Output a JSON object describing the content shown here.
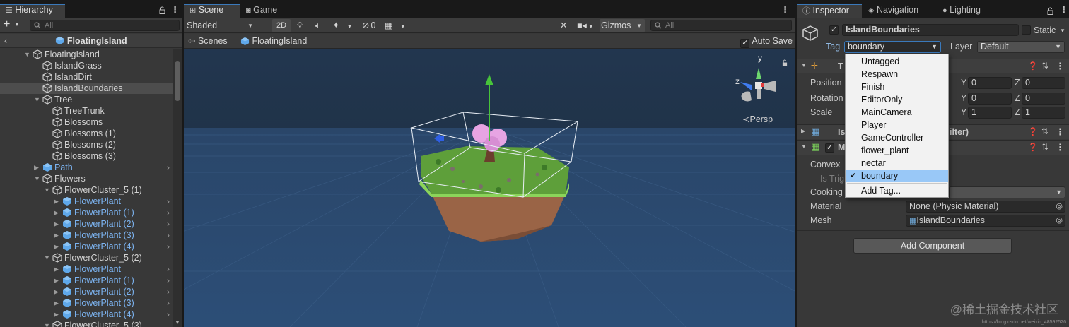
{
  "hierarchy": {
    "tab_label": "Hierarchy",
    "search_placeholder": "All",
    "header_title": "FloatingIsland",
    "items": [
      {
        "label": "FloatingIsland"
      },
      {
        "label": "IslandGrass"
      },
      {
        "label": "IslandDirt"
      },
      {
        "label": "IslandBoundaries"
      },
      {
        "label": "Tree"
      },
      {
        "label": "TreeTrunk"
      },
      {
        "label": "Blossoms"
      },
      {
        "label": "Blossoms (1)"
      },
      {
        "label": "Blossoms (2)"
      },
      {
        "label": "Blossoms (3)"
      },
      {
        "label": "Path"
      },
      {
        "label": "Flowers"
      },
      {
        "label": "FlowerCluster_5 (1)"
      },
      {
        "label": "FlowerPlant"
      },
      {
        "label": "FlowerPlant (1)"
      },
      {
        "label": "FlowerPlant (2)"
      },
      {
        "label": "FlowerPlant (3)"
      },
      {
        "label": "FlowerPlant (4)"
      },
      {
        "label": "FlowerCluster_5 (2)"
      },
      {
        "label": "FlowerPlant"
      },
      {
        "label": "FlowerPlant (1)"
      },
      {
        "label": "FlowerPlant (2)"
      },
      {
        "label": "FlowerPlant (3)"
      },
      {
        "label": "FlowerPlant (4)"
      },
      {
        "label": "FlowerCluster_5 (3)"
      }
    ]
  },
  "scene": {
    "tab_scene": "Scene",
    "tab_game": "Game",
    "shading_mode": "Shaded",
    "btn_2d": "2D",
    "hidden_count": "0",
    "gizmos_label": "Gizmos",
    "search_placeholder": "All",
    "breadcrumb_scenes": "Scenes",
    "breadcrumb_current": "FloatingIsland",
    "auto_save_label": "Auto Save",
    "persp_label": "Persp",
    "axis_y": "y",
    "axis_z": "z"
  },
  "inspector": {
    "tab_inspector": "Inspector",
    "tab_navigation": "Navigation",
    "tab_lighting": "Lighting",
    "object_name": "IslandBoundaries",
    "static_label": "Static",
    "tag_label": "Tag",
    "tag_value": "boundary",
    "layer_label": "Layer",
    "layer_value": "Default",
    "transform_title": "T",
    "position_label": "Position",
    "rotation_label": "Rotation",
    "scale_label": "Scale",
    "y_label": "Y",
    "z_label": "Z",
    "pos_y": "0",
    "pos_z": "0",
    "rot_y": "0",
    "rot_z": "0",
    "scale_y": "1",
    "scale_z": "1",
    "meshfilter_title_prefix": "Is",
    "meshfilter_title_suffix": "ilter)",
    "meshcollider_title": "M",
    "convex_label": "Convex",
    "is_trigger_label": "Is Trig",
    "cooking_label": "Cooking",
    "material_label": "Material",
    "material_value": "None (Physic Material)",
    "mesh_label": "Mesh",
    "mesh_value": "IslandBoundaries",
    "add_component": "Add Component"
  },
  "tag_menu": {
    "items": [
      "Untagged",
      "Respawn",
      "Finish",
      "EditorOnly",
      "MainCamera",
      "Player",
      "GameController",
      "flower_plant",
      "nectar",
      "boundary"
    ],
    "selected": "boundary",
    "add_tag": "Add Tag..."
  },
  "watermark": {
    "text": "@稀土掘金技术社区",
    "url_small": "https://blog.csdn.net/weixin_48592526"
  },
  "colors": {
    "prefab_blue": "#7cb3f0",
    "selection_blue": "#99c8f7",
    "tab_accent": "#3a79bb",
    "scene_sky": "#22364f"
  }
}
